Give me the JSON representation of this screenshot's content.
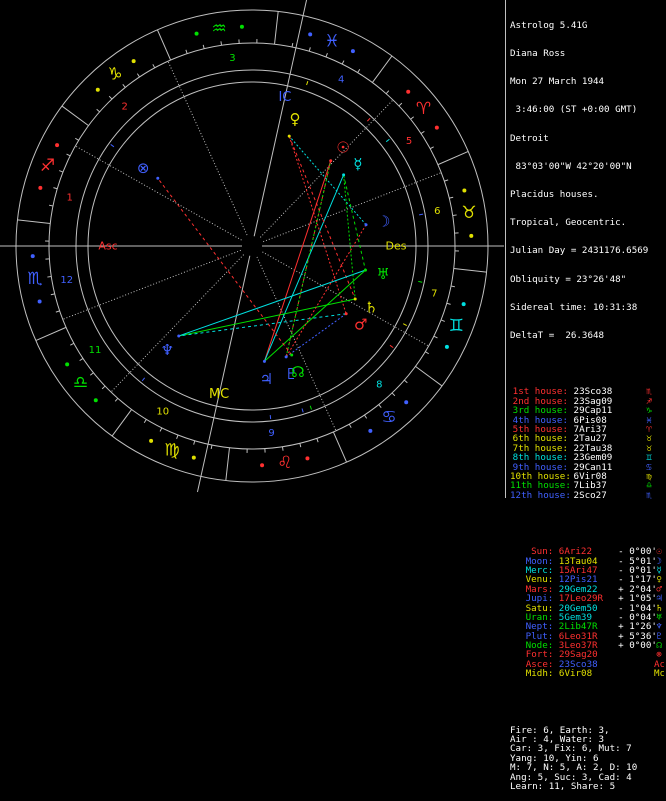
{
  "header": {
    "app": "Astrolog 5.41G",
    "name": "Diana Ross",
    "date": "Mon 27 March 1944",
    "time": " 3:46:00 (ST +0:00 GMT)",
    "place": "Detroit",
    "coords": " 83°03'00\"W 42°20'00\"N",
    "system": "Placidus houses.",
    "zodiac": "Tropical, Geocentric.",
    "julian": "Julian Day = 2431176.6569",
    "obliquity": "Obliquity = 23°26'48\"",
    "sidereal": "Sidereal time: 10:31:38",
    "deltat": "DeltaT =  26.3648"
  },
  "houses": [
    {
      "label": "1st house:",
      "value": "23Sco38",
      "glyph": "♏",
      "color": "#ff3030"
    },
    {
      "label": "2nd house:",
      "value": "23Sag09",
      "glyph": "♐",
      "color": "#ff3030"
    },
    {
      "label": "3rd house:",
      "value": "29Cap11",
      "glyph": "♑",
      "color": "#00e000"
    },
    {
      "label": "4th house:",
      "value": "6Pis08",
      "glyph": "♓",
      "color": "#4060ff"
    },
    {
      "label": "5th house:",
      "value": "7Ari37",
      "glyph": "♈",
      "color": "#ff3030"
    },
    {
      "label": "6th house:",
      "value": "2Tau27",
      "glyph": "♉",
      "color": "#e0e000"
    },
    {
      "label": "7th house:",
      "value": "22Tau38",
      "glyph": "♉",
      "color": "#e0e000"
    },
    {
      "label": "8th house:",
      "value": "23Gem09",
      "glyph": "♊",
      "color": "#00e0e0"
    },
    {
      "label": "9th house:",
      "value": "29Can11",
      "glyph": "♋",
      "color": "#4060ff"
    },
    {
      "label": "10th house:",
      "value": "6Vir08",
      "glyph": "♍",
      "color": "#e0e000"
    },
    {
      "label": "11th house:",
      "value": "7Lib37",
      "glyph": "♎",
      "color": "#00e000"
    },
    {
      "label": "12th house:",
      "value": "2Sco27",
      "glyph": "♏",
      "color": "#4060ff"
    }
  ],
  "planets": [
    {
      "label": "Sun:",
      "value": "6Ari22",
      "aspect": "- 0°00'",
      "glyph": "☉",
      "color": "#ff3030",
      "valcolor": "#ff3030"
    },
    {
      "label": "Moon:",
      "value": "13Tau04",
      "aspect": "- 5°01'",
      "glyph": "☽",
      "color": "#4060ff",
      "valcolor": "#e0e000"
    },
    {
      "label": "Merc:",
      "value": "15Ari47",
      "aspect": "- 0°01'",
      "glyph": "☿",
      "color": "#00e0e0",
      "valcolor": "#ff3030"
    },
    {
      "label": "Venu:",
      "value": "12Pis21",
      "aspect": "- 1°17'",
      "glyph": "♀",
      "color": "#e0e000",
      "valcolor": "#4060ff"
    },
    {
      "label": "Mars:",
      "value": "29Gem22",
      "aspect": "+ 2°04'",
      "glyph": "♂",
      "color": "#ff3030",
      "valcolor": "#00e0e0"
    },
    {
      "label": "Jupi:",
      "value": "17Leo29R",
      "aspect": "+ 1°05'",
      "glyph": "♃",
      "color": "#4060ff",
      "valcolor": "#ff3030"
    },
    {
      "label": "Satu:",
      "value": "20Gem50",
      "aspect": "- 1°04'",
      "glyph": "♄",
      "color": "#e0e000",
      "valcolor": "#00e0e0"
    },
    {
      "label": "Uran:",
      "value": "5Gem39",
      "aspect": "- 0°04'",
      "glyph": "♅",
      "color": "#00e000",
      "valcolor": "#00e0e0"
    },
    {
      "label": "Nept:",
      "value": "2Lib47R",
      "aspect": "+ 1°26'",
      "glyph": "♆",
      "color": "#4060ff",
      "valcolor": "#00e000"
    },
    {
      "label": "Plut:",
      "value": "6Leo31R",
      "aspect": "+ 5°36'",
      "glyph": "♇",
      "color": "#4060ff",
      "valcolor": "#ff3030"
    },
    {
      "label": "Node:",
      "value": "3Leo37R",
      "aspect": "+ 0°00'",
      "glyph": "☊",
      "color": "#00e000",
      "valcolor": "#ff3030"
    },
    {
      "label": "Fort:",
      "value": "29Sag20",
      "aspect": "",
      "glyph": "⊗",
      "color": "#ff3030",
      "valcolor": "#ff3030"
    },
    {
      "label": "Asce:",
      "value": "23Sco38",
      "aspect": "",
      "glyph": "Ac",
      "color": "#ff3030",
      "valcolor": "#4060ff"
    },
    {
      "label": "Midh:",
      "value": "6Vir08",
      "aspect": "",
      "glyph": "Mc",
      "color": "#e0e000",
      "valcolor": "#e0e000"
    }
  ],
  "summary": [
    "Fire: 6, Earth: 3,",
    "Air : 4, Water: 3",
    "Car: 3, Fix: 6, Mut: 7",
    "Yang: 10, Yin: 6",
    "M: 7, N: 5, A: 2, D: 10",
    "Ang: 5, Suc: 3, Cad: 4",
    "Learn: 11, Share: 5"
  ],
  "wheel": {
    "asc_label": "Asc",
    "des_label": "Des",
    "mc_label": "MC",
    "ic_label": "IC",
    "house_numbers": [
      "1",
      "2",
      "3",
      "4",
      "5",
      "6",
      "7",
      "8",
      "9",
      "10",
      "11",
      "12"
    ],
    "sign_glyphs": [
      "♈",
      "♉",
      "♊",
      "♋",
      "♌",
      "♍",
      "♎",
      "♏",
      "♐",
      "♑",
      "♒",
      "♓"
    ]
  }
}
